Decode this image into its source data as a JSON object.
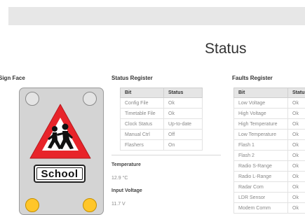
{
  "page": {
    "title": "Status"
  },
  "sign_face": {
    "heading": "Sign Face",
    "panel_text": "School",
    "lamps": {
      "top_left": "off",
      "top_right": "off",
      "bottom_left": "on",
      "bottom_right": "on"
    },
    "colors": {
      "triangle": "#e8242a",
      "lamp_on": "#ffc629",
      "body": "#d4d4d4"
    }
  },
  "status_register": {
    "heading": "Status Register",
    "columns": [
      "Bit",
      "Status"
    ],
    "rows": [
      {
        "bit": "Config File",
        "status": "Ok"
      },
      {
        "bit": "Timetable File",
        "status": "Ok"
      },
      {
        "bit": "Clock Status",
        "status": "Up-to-date"
      },
      {
        "bit": "Manual Ctrl",
        "status": "Off"
      },
      {
        "bit": "Flashers",
        "status": "On"
      }
    ]
  },
  "temperature": {
    "label": "Temperature",
    "value": "12.9 °C"
  },
  "input_voltage": {
    "label": "Input Voltage",
    "value": "11.7 V"
  },
  "faults_register": {
    "heading": "Faults Register",
    "columns": [
      "Bit",
      "Status"
    ],
    "rows": [
      {
        "bit": "Low Voltage",
        "status": "Ok"
      },
      {
        "bit": "High Voltage",
        "status": "Ok"
      },
      {
        "bit": "High Temperature",
        "status": "Ok"
      },
      {
        "bit": "Low Temperature",
        "status": "Ok"
      },
      {
        "bit": "Flash 1",
        "status": "Ok"
      },
      {
        "bit": "Flash 2",
        "status": "Ok"
      },
      {
        "bit": "Radio S-Range",
        "status": "Ok"
      },
      {
        "bit": "Radio L-Range",
        "status": "Ok"
      },
      {
        "bit": "Radar Com",
        "status": "Ok"
      },
      {
        "bit": "LDR Sensor",
        "status": "Ok"
      },
      {
        "bit": "Modem Comm",
        "status": "Ok"
      }
    ]
  }
}
